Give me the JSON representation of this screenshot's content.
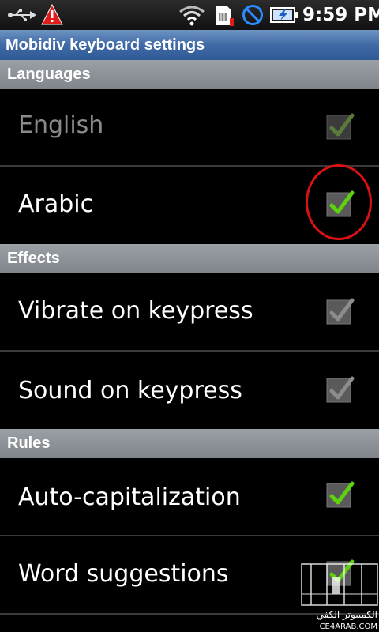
{
  "status_bar": {
    "time": "9:59 PM",
    "icons": [
      "usb-icon",
      "warning-icon",
      "wifi-icon",
      "sim-card-icon",
      "no-signal-icon",
      "battery-charging-icon"
    ]
  },
  "title_bar": {
    "title": "Mobidiv keyboard settings"
  },
  "sections": {
    "languages": "Languages",
    "effects": "Effects",
    "rules": "Rules"
  },
  "items": {
    "english": {
      "label": "English",
      "checked": true,
      "enabled": false
    },
    "arabic": {
      "label": "Arabic",
      "checked": true,
      "enabled": true,
      "highlighted": true
    },
    "vibrate": {
      "label": "Vibrate on keypress",
      "checked": false,
      "enabled": true
    },
    "sound": {
      "label": "Sound on keypress",
      "checked": false,
      "enabled": true
    },
    "autocap": {
      "label": "Auto-capitalization",
      "checked": true,
      "enabled": true
    },
    "suggestions": {
      "label": "Word suggestions",
      "checked": true,
      "enabled": true
    }
  },
  "colors": {
    "title_bar": "#3f6aa5",
    "section_header": "#8a9096",
    "check_green": "#5fd20f",
    "check_grey": "#888888",
    "highlight_circle": "#d81212"
  },
  "watermark": {
    "text": "الكمبيوتر الكفي",
    "url": "CE4ARAB.COM"
  }
}
